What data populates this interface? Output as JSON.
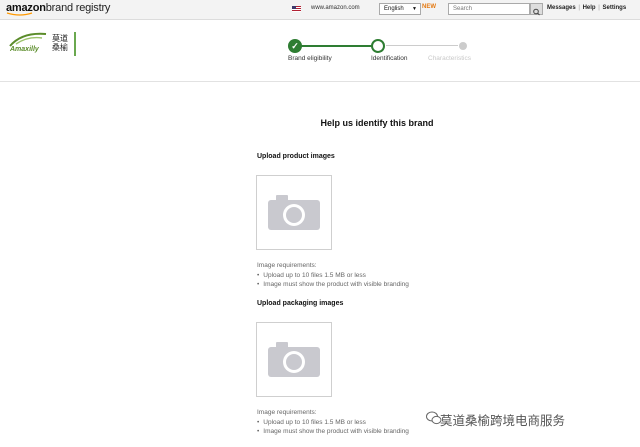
{
  "topbar": {
    "logo_amazon": "amazon",
    "logo_registry": "brand registry",
    "site_url": "www.amazon.com",
    "language": "English",
    "new_label": "NEW",
    "search_placeholder": "Search",
    "links": [
      "Messages",
      "Help",
      "Settings"
    ],
    "link_separator": "|"
  },
  "brand_logo": {
    "latin": "Amaxilly",
    "chinese_line1": "莫道",
    "chinese_line2": "桑榆"
  },
  "stepper": {
    "steps": [
      {
        "label": "Brand eligibility",
        "state": "done"
      },
      {
        "label": "Identification",
        "state": "current"
      },
      {
        "label": "Characteristics",
        "state": "upcoming"
      }
    ],
    "accent": "#2e7d32"
  },
  "main": {
    "heading": "Help us identify this brand",
    "product_images": {
      "title": "Upload product images",
      "requirements_title": "Image requirements:",
      "requirements": [
        "Upload up to 10 files 1.5 MB or less",
        "Image must show the product with visible branding"
      ]
    },
    "packaging_images": {
      "title": "Upload packaging images",
      "requirements_title": "Image requirements:",
      "requirements": [
        "Upload up to 10 files 1.5 MB or less",
        "Image must show the product with visible branding"
      ]
    }
  },
  "watermark": {
    "text": "莫道桑榆跨境电商服务"
  }
}
